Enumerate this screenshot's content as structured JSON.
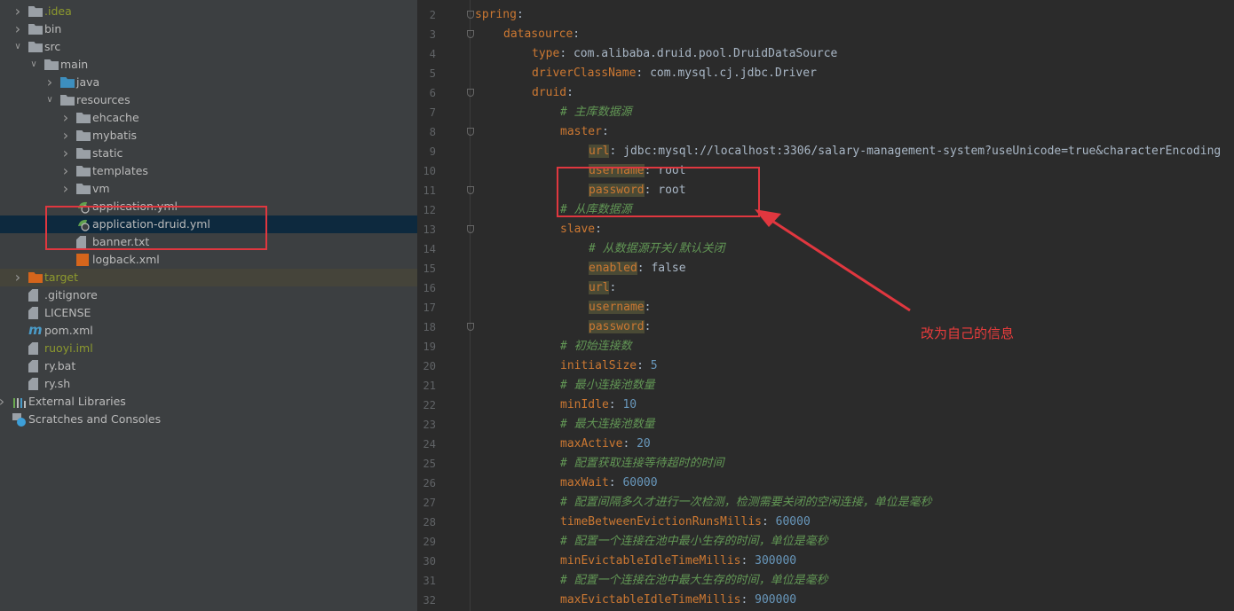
{
  "project_tree": [
    {
      "label": ".idea",
      "depth": 0,
      "arrow": "collapsed",
      "icon": "folder-icon",
      "style": "olive"
    },
    {
      "label": "bin",
      "depth": 0,
      "arrow": "collapsed",
      "icon": "folder-icon"
    },
    {
      "label": "src",
      "depth": 0,
      "arrow": "expanded",
      "icon": "folder-icon"
    },
    {
      "label": "main",
      "depth": 1,
      "arrow": "expanded",
      "icon": "folder-icon"
    },
    {
      "label": "java",
      "depth": 2,
      "arrow": "collapsed",
      "icon": "source-folder-icon"
    },
    {
      "label": "resources",
      "depth": 2,
      "arrow": "expanded",
      "icon": "resources-folder-icon"
    },
    {
      "label": "ehcache",
      "depth": 3,
      "arrow": "collapsed",
      "icon": "folder-icon"
    },
    {
      "label": "mybatis",
      "depth": 3,
      "arrow": "collapsed",
      "icon": "folder-icon"
    },
    {
      "label": "static",
      "depth": 3,
      "arrow": "collapsed",
      "icon": "folder-icon"
    },
    {
      "label": "templates",
      "depth": 3,
      "arrow": "collapsed",
      "icon": "folder-icon"
    },
    {
      "label": "vm",
      "depth": 3,
      "arrow": "collapsed",
      "icon": "folder-icon"
    },
    {
      "label": "application.yml",
      "depth": 3,
      "icon": "spring-yaml-icon"
    },
    {
      "label": "application-druid.yml",
      "depth": 3,
      "icon": "spring-yaml-icon",
      "selected": true
    },
    {
      "label": "banner.txt",
      "depth": 3,
      "icon": "text-file-icon"
    },
    {
      "label": "logback.xml",
      "depth": 3,
      "icon": "xml-file-icon"
    },
    {
      "label": "target",
      "depth": 0,
      "arrow": "collapsed",
      "icon": "excluded-folder-icon",
      "style": "olive",
      "excluded": true
    },
    {
      "label": ".gitignore",
      "depth": 0,
      "icon": "gitignore-file-icon"
    },
    {
      "label": "LICENSE",
      "depth": 0,
      "icon": "text-file-icon"
    },
    {
      "label": "pom.xml",
      "depth": 0,
      "icon": "maven-icon"
    },
    {
      "label": "ruoyi.iml",
      "depth": 0,
      "icon": "iml-file-icon",
      "style": "olive"
    },
    {
      "label": "ry.bat",
      "depth": 0,
      "icon": "unknown-file-icon"
    },
    {
      "label": "ry.sh",
      "depth": 0,
      "icon": "shell-file-icon"
    },
    {
      "label": "External Libraries",
      "depth": -1,
      "arrow": "collapsed",
      "icon": "libraries-icon"
    },
    {
      "label": "Scratches and Consoles",
      "depth": -1,
      "icon": "scratches-icon"
    }
  ],
  "editor": {
    "lines": [
      {
        "n": "2",
        "indent": 0,
        "key": "spring",
        "fold": true
      },
      {
        "n": "3",
        "indent": 1,
        "key": "datasource",
        "fold": true
      },
      {
        "n": "4",
        "indent": 2,
        "key": "type",
        "value": "com.alibaba.druid.pool.DruidDataSource",
        "vtype": "v"
      },
      {
        "n": "5",
        "indent": 2,
        "key": "driverClassName",
        "value": "com.mysql.cj.jdbc.Driver",
        "vtype": "v"
      },
      {
        "n": "6",
        "indent": 2,
        "key": "druid",
        "fold": true
      },
      {
        "n": "7",
        "indent": 3,
        "comment": "# 主库数据源"
      },
      {
        "n": "8",
        "indent": 3,
        "key": "master",
        "fold": true
      },
      {
        "n": "9",
        "indent": 4,
        "key": "url",
        "value": "jdbc:mysql://localhost:3306/salary-management-system?useUnicode=true&characterEncoding",
        "vtype": "v",
        "hl": true
      },
      {
        "n": "10",
        "indent": 4,
        "key": "username",
        "value": "root",
        "vtype": "v",
        "hl": true
      },
      {
        "n": "11",
        "indent": 4,
        "key": "password",
        "value": "root",
        "vtype": "v",
        "hl": true,
        "fold": true
      },
      {
        "n": "12",
        "indent": 3,
        "comment": "# 从库数据源"
      },
      {
        "n": "13",
        "indent": 3,
        "key": "slave",
        "fold": true
      },
      {
        "n": "14",
        "indent": 4,
        "comment": "# 从数据源开关/默认关闭"
      },
      {
        "n": "15",
        "indent": 4,
        "key": "enabled",
        "value": "false",
        "vtype": "v",
        "hl": true
      },
      {
        "n": "16",
        "indent": 4,
        "key": "url",
        "hl": true
      },
      {
        "n": "17",
        "indent": 4,
        "key": "username",
        "hl": true
      },
      {
        "n": "18",
        "indent": 4,
        "key": "password",
        "hl": true,
        "fold": true
      },
      {
        "n": "19",
        "indent": 3,
        "comment": "# 初始连接数"
      },
      {
        "n": "20",
        "indent": 3,
        "key": "initialSize",
        "value": "5",
        "vtype": "n"
      },
      {
        "n": "21",
        "indent": 3,
        "comment": "# 最小连接池数量"
      },
      {
        "n": "22",
        "indent": 3,
        "key": "minIdle",
        "value": "10",
        "vtype": "n"
      },
      {
        "n": "23",
        "indent": 3,
        "comment": "# 最大连接池数量"
      },
      {
        "n": "24",
        "indent": 3,
        "key": "maxActive",
        "value": "20",
        "vtype": "n"
      },
      {
        "n": "25",
        "indent": 3,
        "comment": "# 配置获取连接等待超时的时间"
      },
      {
        "n": "26",
        "indent": 3,
        "key": "maxWait",
        "value": "60000",
        "vtype": "n"
      },
      {
        "n": "27",
        "indent": 3,
        "comment": "# 配置间隔多久才进行一次检测，检测需要关闭的空闲连接，单位是毫秒"
      },
      {
        "n": "28",
        "indent": 3,
        "key": "timeBetweenEvictionRunsMillis",
        "value": "60000",
        "vtype": "n"
      },
      {
        "n": "29",
        "indent": 3,
        "comment": "# 配置一个连接在池中最小生存的时间，单位是毫秒"
      },
      {
        "n": "30",
        "indent": 3,
        "key": "minEvictableIdleTimeMillis",
        "value": "300000",
        "vtype": "n"
      },
      {
        "n": "31",
        "indent": 3,
        "comment": "# 配置一个连接在池中最大生存的时间，单位是毫秒"
      },
      {
        "n": "32",
        "indent": 3,
        "key": "maxEvictableIdleTimeMillis",
        "value": "900000",
        "vtype": "n"
      }
    ]
  },
  "annotation": {
    "note": "改为自己的信息",
    "color": "#e0373f"
  },
  "colors": {
    "sidebar_bg": "#3c3f41",
    "editor_bg": "#2b2b2b",
    "yaml_key": "#cc7832",
    "string_value": "#a9b7c6",
    "number_value": "#6897bb",
    "comment": "#629755",
    "selection": "#0d293e"
  }
}
